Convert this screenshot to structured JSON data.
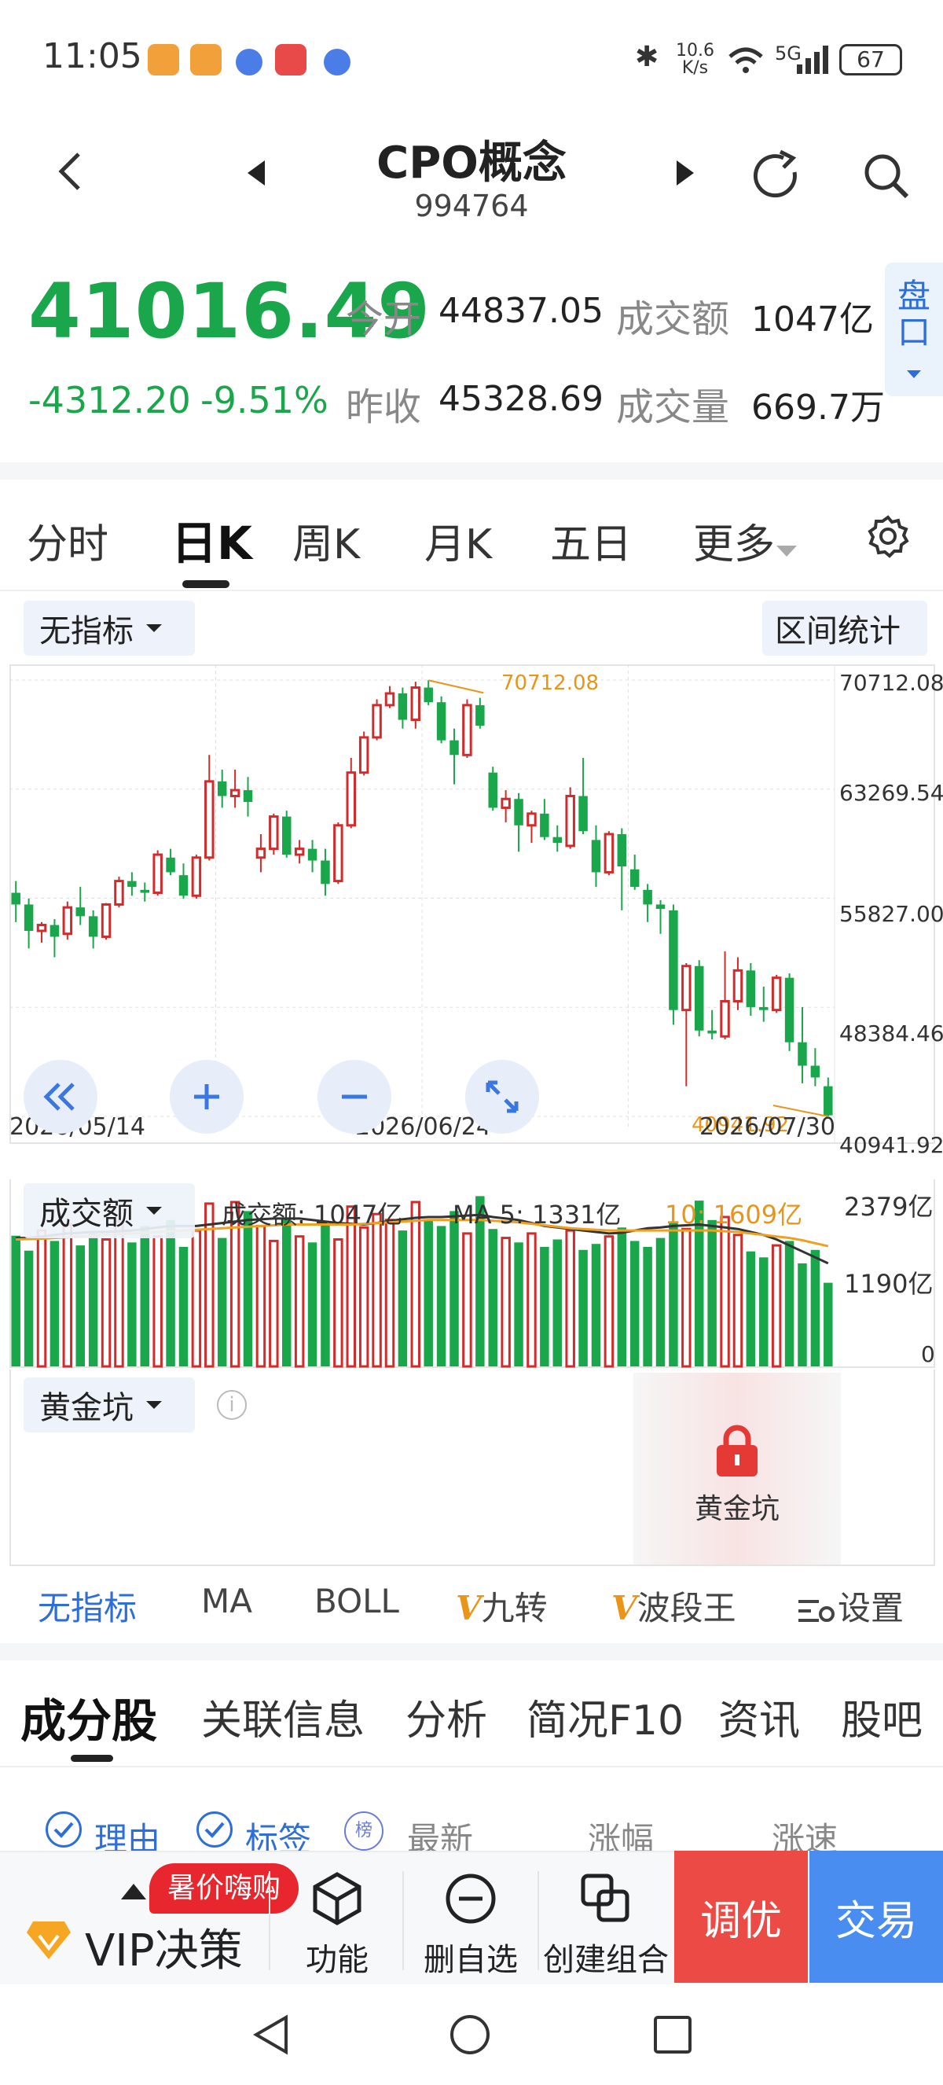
{
  "status_bar": {
    "time": "11:05",
    "net_speed_top": "10.6",
    "net_speed_bottom": "K/s",
    "network": "5G",
    "battery": "67"
  },
  "header": {
    "title": "CPO概念",
    "code": "994764"
  },
  "quote": {
    "price": "41016.49",
    "change": "-4312.20",
    "change_pct": "-9.51%",
    "open_label": "今开",
    "open": "44837.05",
    "turnover_label": "成交额",
    "turnover": "1047亿",
    "prev_close_label": "昨收",
    "prev_close": "45328.69",
    "volume_label": "成交量",
    "volume": "669.7万",
    "pankou_label": "盘口",
    "up_color": "#d12b2b",
    "down_color": "#1aa64a"
  },
  "period_tabs": [
    "分时",
    "日K",
    "周K",
    "月K",
    "五日",
    "更多"
  ],
  "chart_controls": {
    "indicator_dropdown": "无指标",
    "range_stats": "区间统计",
    "volume_dropdown": "成交额",
    "gold_dropdown": "黄金坑",
    "gold_label": "黄金坑"
  },
  "volume_legend": {
    "text1": "成交额: 1047亿",
    "text2": "MA 5: 1331亿",
    "text3": "10: 1609亿"
  },
  "indicator_tabs": [
    "无指标",
    "MA",
    "BOLL",
    "九转",
    "波段王",
    "设置"
  ],
  "section_tabs": [
    "成分股",
    "关联信息",
    "分析",
    "简况F10",
    "资讯",
    "股吧"
  ],
  "list_filters": {
    "reason": "理由",
    "tag": "标签",
    "rank_badge": "榜",
    "latest": "最新",
    "change": "涨幅",
    "speed": "涨速"
  },
  "bottom_bar": {
    "promo": "暑价嗨购",
    "vip": "VIP决策",
    "function": "功能",
    "remove_watch": "删自选",
    "create_group": "创建组合",
    "tune": "调优",
    "trade": "交易"
  },
  "chart_data": {
    "type": "candlestick",
    "x_ticks": [
      "2026/05/14",
      "2026/06/24",
      "2026/07/30"
    ],
    "y_ticks": [
      "70712.08",
      "63269.54",
      "55827.00",
      "48384.46",
      "40941.92"
    ],
    "ylim": [
      40941.92,
      70712.08
    ],
    "annotations": [
      {
        "label": "70712.08",
        "type": "max"
      },
      {
        "label": "40941.92",
        "type": "min"
      }
    ],
    "candles": [
      [
        56200,
        57000,
        54200,
        55400
      ],
      [
        55400,
        55800,
        52400,
        53600
      ],
      [
        53600,
        54200,
        52800,
        54000
      ],
      [
        54000,
        54400,
        51800,
        53200
      ],
      [
        53400,
        55600,
        53000,
        55200
      ],
      [
        55200,
        56600,
        54000,
        54600
      ],
      [
        54600,
        55000,
        52400,
        53200
      ],
      [
        53200,
        55500,
        53000,
        55400
      ],
      [
        55400,
        57300,
        55200,
        57000
      ],
      [
        57000,
        57600,
        56000,
        56600
      ],
      [
        56400,
        56900,
        55600,
        56200
      ],
      [
        56200,
        59100,
        56000,
        58800
      ],
      [
        58600,
        59200,
        57400,
        57600
      ],
      [
        57400,
        58200,
        55800,
        56000
      ],
      [
        56000,
        58800,
        55800,
        58600
      ],
      [
        58600,
        65600,
        58400,
        63800
      ],
      [
        63800,
        64600,
        62000,
        62800
      ],
      [
        62800,
        64600,
        62000,
        63200
      ],
      [
        63200,
        64100,
        61400,
        62400
      ],
      [
        58600,
        60200,
        57600,
        59200
      ],
      [
        59200,
        61600,
        58800,
        61400
      ],
      [
        61400,
        61800,
        58600,
        58800
      ],
      [
        58800,
        59800,
        58200,
        59200
      ],
      [
        59200,
        59800,
        57600,
        58400
      ],
      [
        58400,
        59200,
        56000,
        56800
      ],
      [
        57000,
        61000,
        56800,
        60800
      ],
      [
        60800,
        65400,
        60600,
        64400
      ],
      [
        64400,
        67200,
        64200,
        66800
      ],
      [
        66800,
        69400,
        66600,
        69000
      ],
      [
        69000,
        70300,
        68800,
        69800
      ],
      [
        69800,
        70200,
        67400,
        68000
      ],
      [
        68000,
        70600,
        67400,
        70200
      ],
      [
        70200,
        70700,
        69000,
        69200
      ],
      [
        69200,
        69600,
        66400,
        66600
      ],
      [
        66600,
        67400,
        63600,
        65600
      ],
      [
        65600,
        69400,
        65400,
        69000
      ],
      [
        69000,
        69500,
        67400,
        67600
      ],
      [
        64400,
        64800,
        61800,
        62000
      ],
      [
        62000,
        63200,
        61000,
        62600
      ],
      [
        62600,
        63000,
        59000,
        60800
      ],
      [
        60800,
        61800,
        59600,
        61600
      ],
      [
        61600,
        62600,
        59800,
        60000
      ],
      [
        60000,
        60800,
        59000,
        59600
      ],
      [
        59400,
        63400,
        59200,
        62800
      ],
      [
        62800,
        65400,
        60200,
        60400
      ],
      [
        59800,
        60800,
        56600,
        57600
      ],
      [
        57600,
        60400,
        57400,
        60200
      ],
      [
        60200,
        60600,
        55000,
        58000
      ],
      [
        57800,
        58800,
        56400,
        56600
      ],
      [
        56400,
        56800,
        54200,
        55400
      ],
      [
        55400,
        55700,
        53400,
        55100
      ],
      [
        55000,
        55400,
        47200,
        48200
      ],
      [
        48200,
        51400,
        43000,
        51200
      ],
      [
        51200,
        51600,
        46400,
        46800
      ],
      [
        46800,
        48200,
        46200,
        46600
      ],
      [
        46400,
        52200,
        46200,
        48800
      ],
      [
        48800,
        51800,
        48200,
        50900
      ],
      [
        50900,
        51400,
        47800,
        48400
      ],
      [
        48400,
        49800,
        47400,
        48200
      ],
      [
        48200,
        50600,
        48000,
        50400
      ],
      [
        50400,
        50700,
        45400,
        46000
      ],
      [
        46000,
        48400,
        43200,
        44400
      ],
      [
        44400,
        45600,
        43000,
        43600
      ],
      [
        43000,
        43600,
        40941,
        41016
      ]
    ],
    "volume_axis": [
      "2379亿",
      "1190亿",
      "0"
    ],
    "volume_ylim": [
      0,
      2379
    ],
    "volume_values": [
      1750,
      1550,
      1820,
      1680,
      1900,
      1620,
      1780,
      1700,
      1940,
      1660,
      1880,
      1740,
      1960,
      1600,
      1820,
      2180,
      1720,
      2200,
      2080,
      1880,
      1680,
      1980,
      1740,
      1660,
      1900,
      1700,
      2140,
      1860,
      2040,
      1960,
      1820,
      2200,
      1960,
      1880,
      2080,
      1780,
      2280,
      1840,
      1720,
      1660,
      1780,
      1600,
      1700,
      1820,
      1560,
      1640,
      1740,
      1860,
      1680,
      1600,
      1720,
      1920,
      1840,
      2220,
      1960,
      2000,
      1760,
      1540,
      1460,
      1620,
      1680,
      1380,
      1560,
      1120
    ],
    "ma5_values": [
      1720,
      1720,
      1740,
      1760,
      1780,
      1790,
      1800,
      1800,
      1810,
      1820,
      1840,
      1860,
      1880,
      1880,
      1880,
      1900,
      1920,
      1940,
      1960,
      1970,
      1980,
      1980,
      1980,
      1960,
      1940,
      1920,
      1910,
      1900,
      1920,
      1950,
      1970,
      1990,
      2000,
      2000,
      2010,
      2020,
      2030,
      2000,
      1980,
      1960,
      1920,
      1880,
      1860,
      1840,
      1820,
      1800,
      1780,
      1790,
      1820,
      1850,
      1860,
      1880,
      1890,
      1900,
      1880,
      1860,
      1840,
      1800,
      1760,
      1700,
      1620,
      1540,
      1460,
      1380
    ],
    "ma10_values": [
      1700,
      1705,
      1710,
      1720,
      1730,
      1740,
      1750,
      1760,
      1770,
      1780,
      1790,
      1800,
      1810,
      1820,
      1830,
      1840,
      1850,
      1860,
      1870,
      1880,
      1890,
      1900,
      1900,
      1900,
      1900,
      1900,
      1900,
      1910,
      1920,
      1930,
      1940,
      1950,
      1960,
      1960,
      1960,
      1960,
      1960,
      1950,
      1940,
      1930,
      1910,
      1890,
      1870,
      1850,
      1840,
      1830,
      1820,
      1820,
      1820,
      1820,
      1820,
      1820,
      1820,
      1820,
      1820,
      1810,
      1800,
      1780,
      1760,
      1740,
      1720,
      1690,
      1650,
      1609
    ]
  }
}
